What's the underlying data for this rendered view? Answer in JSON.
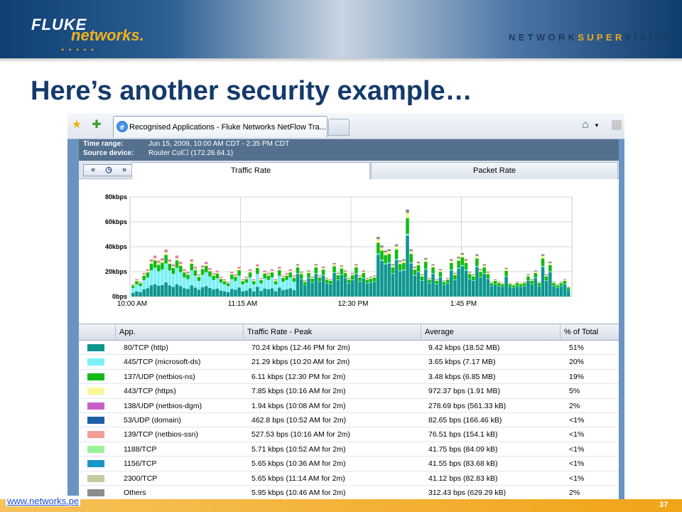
{
  "header": {
    "logo_text_1": "FLUKE",
    "logo_text_2": "networks.",
    "tagline_1": "NETWORK",
    "tagline_2": "SUPER",
    "tagline_3": "VISION"
  },
  "slide": {
    "title": "Here’s another security example…",
    "footer_url": "www.networks.pe",
    "page_number": "37"
  },
  "browser": {
    "tab_title": "Recognised Applications - Fluke Networks NetFlow Tra...",
    "icons": [
      "star-icon",
      "add-favorite-icon",
      "home-icon",
      "rss-icon"
    ]
  },
  "report": {
    "time_range_label": "Time range:",
    "time_range_value": "Jun 15, 2009, 10:00 AM CDT - 2:35 PM CDT",
    "source_label": "Source device:",
    "source_value": "Router Col☐ (172.26.64.1)",
    "tabs": [
      "Traffic Rate",
      "Packet Rate"
    ],
    "active_tab": "Traffic Rate"
  },
  "chart_data": {
    "type": "bar",
    "stacked": true,
    "y_ticks": [
      "80kbps",
      "60kbps",
      "40kbps",
      "20kbps",
      "0bps"
    ],
    "x_ticks": [
      "10:00 AM",
      "11:15 AM",
      "12:30 PM",
      "1:45 PM"
    ],
    "ylim": [
      0,
      80
    ],
    "unit": "kbps",
    "peaks_kbps": [
      10,
      14,
      12,
      19,
      22,
      30,
      33,
      29,
      31,
      38,
      30,
      26,
      33,
      28,
      22,
      20,
      30,
      24,
      18,
      25,
      28,
      23,
      19,
      21,
      16,
      14,
      12,
      20,
      18,
      24,
      14,
      16,
      22,
      14,
      26,
      15,
      21,
      19,
      22,
      14,
      24,
      17,
      19,
      22,
      17,
      26,
      20,
      13,
      21,
      16,
      26,
      17,
      24,
      15,
      14,
      27,
      19,
      25,
      21,
      15,
      19,
      26,
      17,
      21,
      15,
      16,
      17,
      48,
      41,
      37,
      38,
      26,
      42,
      29,
      30,
      70,
      38,
      24,
      28,
      18,
      31,
      15,
      26,
      14,
      22,
      13,
      15,
      30,
      19,
      32,
      35,
      30,
      20,
      18,
      34,
      22,
      26,
      20,
      12,
      14,
      12,
      11,
      23,
      11,
      10,
      12,
      11,
      12,
      18,
      14,
      21,
      12,
      34,
      18,
      28,
      12,
      10,
      12,
      14,
      8
    ]
  },
  "table": {
    "columns": [
      "App.",
      "Traffic Rate - Peak",
      "Average",
      "% of Total"
    ],
    "rows": [
      {
        "color": "#0e9690",
        "app": "80/TCP (http)",
        "peak": "70.24 kbps (12:46 PM for 2m)",
        "avg": "9.42 kbps (18.52 MB)",
        "pct": "51%"
      },
      {
        "color": "#7df0f6",
        "app": "445/TCP (microsoft-ds)",
        "peak": "21.29 kbps (10:20 AM for 2m)",
        "avg": "3.65 kbps (7.17 MB)",
        "pct": "20%"
      },
      {
        "color": "#11bb17",
        "app": "137/UDP (netbios-ns)",
        "peak": "6.11 kbps (12:30 PM for 2m)",
        "avg": "3.48 kbps (6.85 MB)",
        "pct": "19%"
      },
      {
        "color": "#f8f89a",
        "app": "443/TCP (https)",
        "peak": "7.85 kbps (10:16 AM for 2m)",
        "avg": "972.37 bps (1.91 MB)",
        "pct": "5%"
      },
      {
        "color": "#c561c7",
        "app": "138/UDP (netbios-dgm)",
        "peak": "1.94 kbps (10:08 AM for 2m)",
        "avg": "278.69 bps (561.33 kB)",
        "pct": "2%"
      },
      {
        "color": "#1d5ea5",
        "app": "53/UDP (domain)",
        "peak": "462.8 bps (10:52 AM for 2m)",
        "avg": "82.65 bps (166.46 kB)",
        "pct": "<1%"
      },
      {
        "color": "#f59d97",
        "app": "139/TCP (netbios-ssn)",
        "peak": "527.53 bps (10:16 AM for 2m)",
        "avg": "76.51 bps (154.1 kB)",
        "pct": "<1%"
      },
      {
        "color": "#9ef19b",
        "app": "1188/TCP",
        "peak": "5.71 kbps (10:52 AM for 2m)",
        "avg": "41.75 bps (84.09 kB)",
        "pct": "<1%"
      },
      {
        "color": "#1a95c8",
        "app": "1156/TCP",
        "peak": "5.65 kbps (10:36 AM for 2m)",
        "avg": "41.55 bps (83.68 kB)",
        "pct": "<1%"
      },
      {
        "color": "#c7c9a0",
        "app": "2300/TCP",
        "peak": "5.65 kbps (11:14 AM for 2m)",
        "avg": "41.12 bps (82.83 kB)",
        "pct": "<1%"
      },
      {
        "color": "#8d8d8d",
        "app": "Others",
        "peak": "5.95 kbps (10:46 AM for 2m)",
        "avg": "312.43 bps (629.29 kB)",
        "pct": "2%"
      }
    ]
  }
}
